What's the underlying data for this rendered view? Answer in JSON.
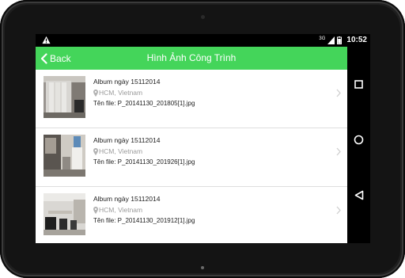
{
  "status_bar": {
    "network": "3G",
    "time": "10:52"
  },
  "app_bar": {
    "back_label": "Back",
    "title": "Hình Ảnh Công Trình",
    "color": "#44d55a"
  },
  "items": [
    {
      "title": "Album ngày 15112014",
      "location": "HCM, Vietnam",
      "file": "Tên file: P_20141130_201805[1].jpg"
    },
    {
      "title": "Album ngày 15112014",
      "location": "HCM, Vietnam",
      "file": "Tên file: P_20141130_201926[1].jpg"
    },
    {
      "title": "Album ngày 15112014",
      "location": "HCM, Vietnam",
      "file": "Tên file: P_20141130_201912[1].jpg"
    }
  ],
  "icons": {
    "status_left": "warning-icon",
    "back": "chevron-left-icon",
    "location": "location-pin-icon",
    "row_action": "chevron-right-icon",
    "nav": [
      "recents-square-icon",
      "home-circle-icon",
      "back-triangle-icon"
    ]
  }
}
